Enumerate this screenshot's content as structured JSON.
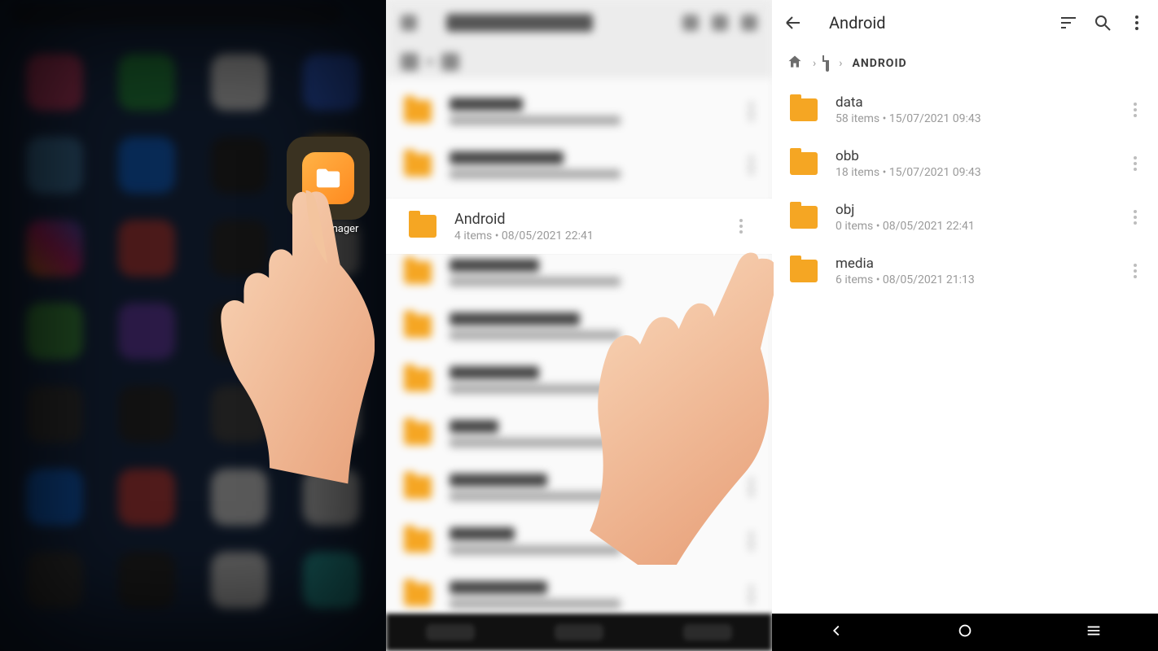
{
  "panel1": {
    "app_label": "File Manager"
  },
  "panel2": {
    "focused_item": {
      "name": "Android",
      "subtitle": "4 items • 08/05/2021 22:41"
    }
  },
  "panel3": {
    "appbar": {
      "title": "Android"
    },
    "breadcrumb": {
      "final": "ANDROID"
    },
    "items": [
      {
        "name": "data",
        "subtitle": "58 items • 15/07/2021 09:43"
      },
      {
        "name": "obb",
        "subtitle": "18 items • 15/07/2021 09:43"
      },
      {
        "name": "obj",
        "subtitle": "0 items • 08/05/2021 22:41"
      },
      {
        "name": "media",
        "subtitle": "6 items • 08/05/2021 21:13"
      }
    ]
  }
}
